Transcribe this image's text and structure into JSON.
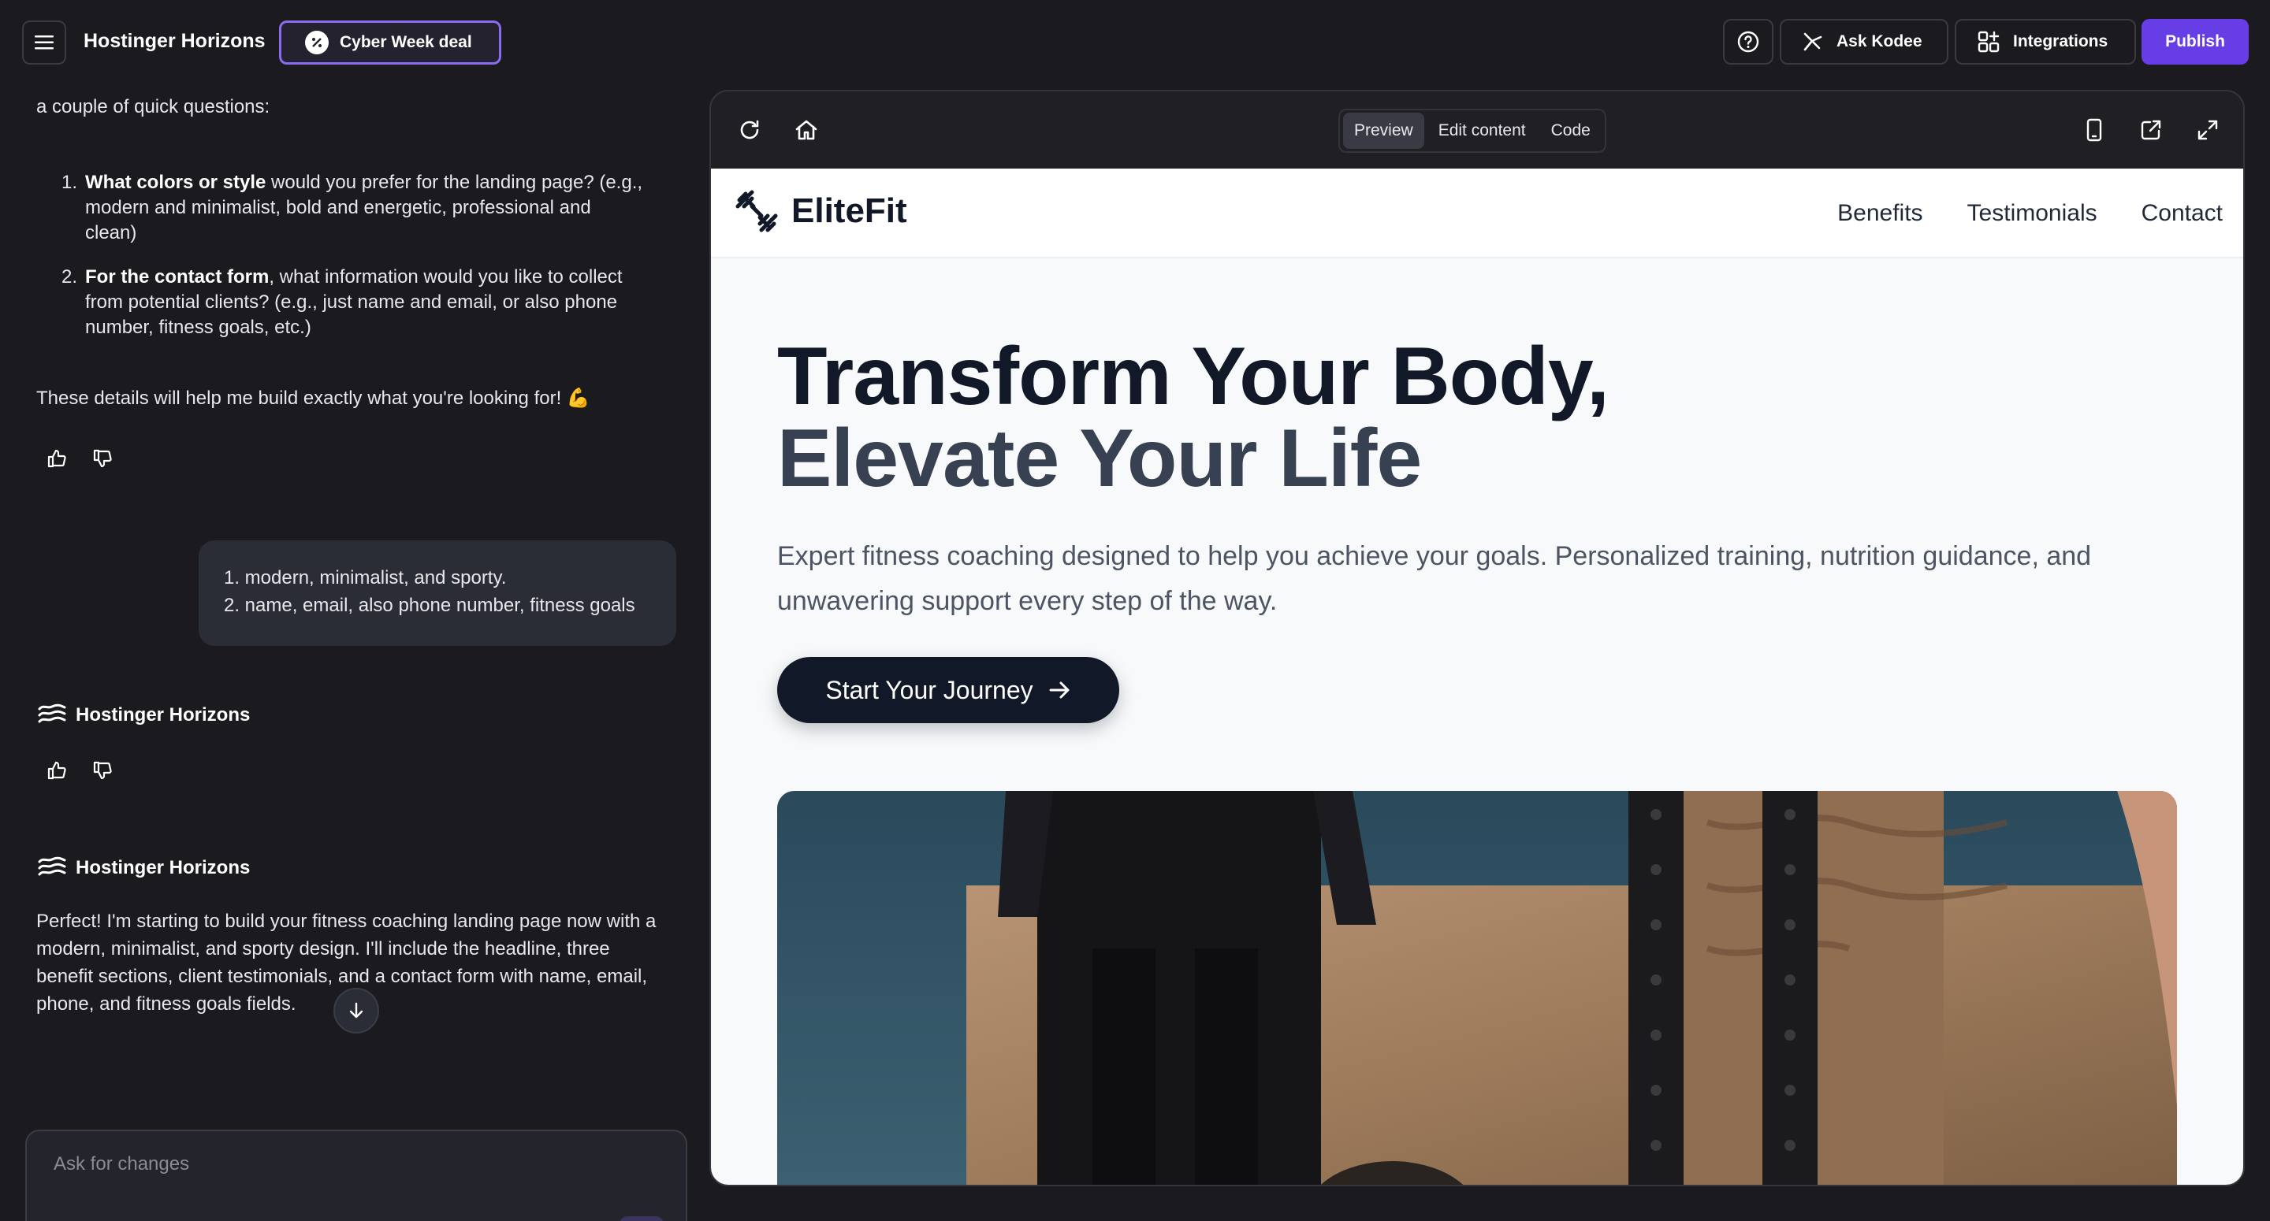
{
  "topbar": {
    "app_title": "Hostinger Horizons",
    "deal_label": "Cyber Week deal",
    "ask_label": "Ask Kodee",
    "integrations_label": "Integrations",
    "publish_label": "Publish"
  },
  "chat": {
    "intro": "a couple of quick questions:",
    "questions": [
      {
        "num": "1.",
        "bold": "What colors or style",
        "rest_line1": " would you prefer for the landing page? (e.g.,",
        "rest_line2": "modern and minimalist, bold and energetic, professional and",
        "rest_line3": "clean)"
      },
      {
        "num": "2.",
        "bold": "For the contact form",
        "rest_line1": ", what information would you like to collect",
        "rest_line2": "from potential clients? (e.g., just name and email, or also phone",
        "rest_line3": "number, fitness goals, etc.)"
      }
    ],
    "details_text": "These details will help me build exactly what you're looking for! 💪",
    "user_reply_line1": "1. modern, minimalist, and sporty.",
    "user_reply_line2": "2. name, email, also phone number, fitness goals",
    "bot_name": "Hostinger Horizons",
    "final_message": "Perfect! I'm starting to build your fitness coaching landing page now with a modern, minimalist, and sporty design. I'll include the headline, three benefit sections, client testimonials, and a contact form with name, email, phone, and fitness goals fields.",
    "composer_placeholder": "Ask for changes"
  },
  "preview": {
    "tabs": [
      "Preview",
      "Edit content",
      "Code"
    ],
    "active_tab": "Preview"
  },
  "site": {
    "brand": "EliteFit",
    "nav": [
      "Benefits",
      "Testimonials",
      "Contact"
    ],
    "hero_line1": "Transform Your Body,",
    "hero_line2": "Elevate Your Life",
    "hero_sub": "Expert fitness coaching designed to help you achieve your goals. Personalized training, nutrition guidance, and unwavering support every step of the way.",
    "cta_label": "Start Your Journey"
  },
  "colors": {
    "accent": "#673de6",
    "deal_border": "#8b6cf0",
    "app_bg": "#1a1a1f",
    "site_dark": "#111827"
  },
  "icons": [
    "menu-icon",
    "discount-icon",
    "help-icon",
    "kodee-icon",
    "integrations-icon",
    "thumbs-up-icon",
    "thumbs-down-icon",
    "horizons-logo-icon",
    "arrow-down-icon",
    "image-icon",
    "pointer-icon",
    "mic-icon",
    "send-icon",
    "refresh-icon",
    "home-icon",
    "mobile-icon",
    "external-link-icon",
    "expand-icon",
    "dumbbell-icon",
    "arrow-right-icon"
  ]
}
